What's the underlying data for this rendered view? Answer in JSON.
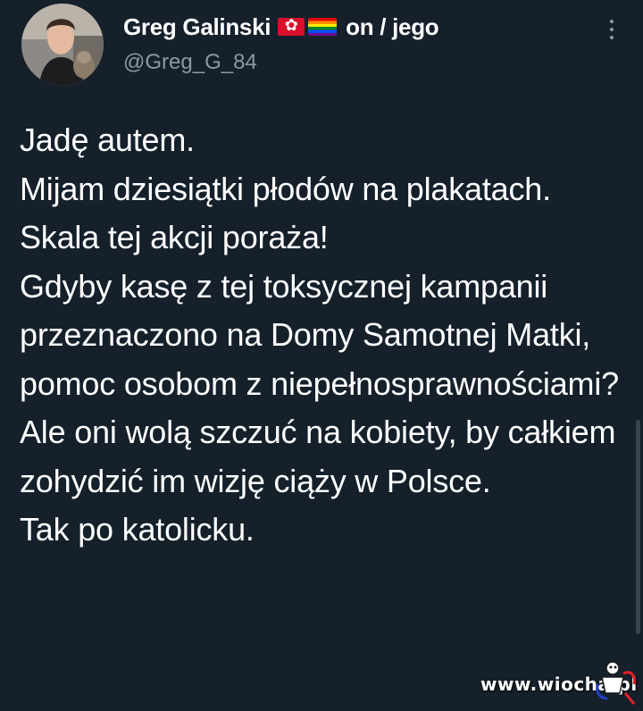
{
  "author": {
    "display_name": "Greg Galinski",
    "pronouns": "on / jego",
    "handle": "@Greg_G_84",
    "flags": [
      "hong-kong-flag-icon",
      "rainbow-flag-icon"
    ]
  },
  "tweet": {
    "text": "Jadę autem.\nMijam dziesiątki płodów na plakatach.\nSkala tej akcji poraża!\nGdyby kasę z tej toksycznej kampanii przeznaczono na Domy Samotnej Matki, pomoc osobom z niepełnosprawnościami?\nAle oni wolą szczuć na kobiety, by całkiem zohydzić im wizję ciąży w Polsce.\nTak po katolicku."
  },
  "watermark": {
    "text": "www.wiocha.pl"
  },
  "colors": {
    "background": "#15202b",
    "secondary_text": "#8899a6",
    "primary_text": "#ffffff"
  }
}
